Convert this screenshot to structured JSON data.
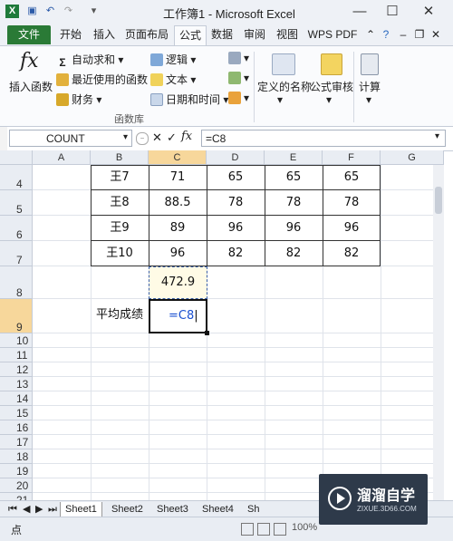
{
  "window": {
    "title": "工作簿1 - Microsoft Excel",
    "controls": [
      "—",
      "☐",
      "✕"
    ]
  },
  "quick_access": [
    "save-icon",
    "undo-icon",
    "redo-icon"
  ],
  "tabs": [
    "文件",
    "开始",
    "插入",
    "页面布局",
    "公式",
    "数据",
    "审阅",
    "视图",
    "WPS PDF"
  ],
  "active_tab": "公式",
  "ribbon": {
    "insert_function": "插入函数",
    "autosum": "自动求和",
    "recent": "最近使用的函数",
    "financial": "财务",
    "logical": "逻辑",
    "text": "文本",
    "datetime": "日期和时间",
    "defined_names": "定义的名称",
    "formula_audit": "公式审核",
    "calculation": "计算",
    "group_label": "函数库"
  },
  "formula_bar": {
    "name_box": "COUNT",
    "fx": "fx",
    "formula": "=C8"
  },
  "columns": [
    "A",
    "B",
    "C",
    "D",
    "E",
    "F",
    "G"
  ],
  "rows": [
    "4",
    "5",
    "6",
    "7",
    "8",
    "9",
    "10",
    "11",
    "12",
    "13",
    "14",
    "15",
    "16",
    "17",
    "18",
    "19",
    "20",
    "21"
  ],
  "table": [
    [
      "王7",
      "71",
      "65",
      "65",
      "65"
    ],
    [
      "王8",
      "88.5",
      "78",
      "78",
      "78"
    ],
    [
      "王9",
      "89",
      "96",
      "96",
      "96"
    ],
    [
      "王10",
      "96",
      "82",
      "82",
      "82"
    ]
  ],
  "c8_value": "472.9",
  "b9_label": "平均成绩",
  "c9_edit": "=C8",
  "sheet_tabs": [
    "Sheet1",
    "Sheet2",
    "Sheet3",
    "Sheet4",
    "Sh"
  ],
  "status": {
    "mode": "点",
    "zoom": "100%"
  },
  "watermark": {
    "name": "溜溜自学",
    "url": "ZIXUE.3D66.COM"
  }
}
